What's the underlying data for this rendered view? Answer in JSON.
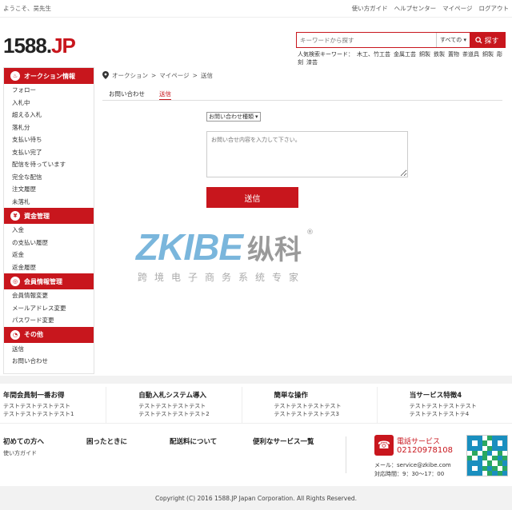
{
  "topbar": {
    "welcome": "ようこそ、吴先生",
    "links": [
      "使い方ガイド",
      "ヘルプセンター",
      "マイページ",
      "ログアウト"
    ]
  },
  "logo": {
    "main": "1588.",
    "accent": "JP"
  },
  "search": {
    "placeholder": "キーワードから探す",
    "category": "すべての",
    "button": "探す",
    "hot_label": "人気検索キーワード：",
    "hot_keywords": [
      "木工、竹工芸",
      "金属工芸",
      "銅製",
      "鉄製",
      "置物",
      "茶道具",
      "銅製",
      "彫刻",
      "漆芸"
    ]
  },
  "sidebar": {
    "sections": [
      {
        "title": "オークション情報",
        "icon": "auction-icon",
        "items": [
          "フォロー",
          "入札中",
          "超える入札",
          "落札分",
          "支払い待ち",
          "支払い完了",
          "配信を待っています",
          "完全な配信",
          "注文履歴",
          "未落札"
        ]
      },
      {
        "title": "資金管理",
        "icon": "yen-icon",
        "items": [
          "入金",
          "の支払い履歴",
          "返金",
          "返金履歴"
        ]
      },
      {
        "title": "会員情報管理",
        "icon": "member-icon",
        "items": [
          "会員情報変更",
          "メールアドレス変更",
          "パスワード変更"
        ]
      },
      {
        "title": "その他",
        "icon": "other-icon",
        "items": [
          "送信",
          "お問い合わせ"
        ]
      }
    ]
  },
  "breadcrumb": [
    "オークション",
    "マイページ",
    "送信"
  ],
  "tabs": [
    "お問い合わせ",
    "送信"
  ],
  "form": {
    "type_select": "お問い合わせ種類",
    "textarea_placeholder": "お問い合せ内容を入力して下さい。",
    "submit": "送信"
  },
  "watermark": {
    "latin": "ZKIBE",
    "cjk": "纵科",
    "tagline": "跨境电子商务系统专家",
    "reg": "®"
  },
  "features": [
    {
      "title": "年間会員制一番お得",
      "lines": [
        "テストテストテストテスト",
        "テストテストテストテスト1"
      ]
    },
    {
      "title": "自動入札システム導入",
      "lines": [
        "テストテストテストテスト",
        "テストテストテストテスト2"
      ]
    },
    {
      "title": "簡単な操作",
      "lines": [
        "テストテストテストテスト",
        "テストテストテストテス3"
      ]
    },
    {
      "title": "当サービス特徴4",
      "lines": [
        "テストテストテストテスト",
        "テストテストテストテ4"
      ]
    }
  ],
  "help": {
    "cols": [
      "初めての方へ",
      "困ったときに",
      "配送料について",
      "便利なサービス一覧"
    ],
    "guide_link": "使い方ガイド",
    "phone_label": "電話サービス",
    "phone_number": "02120978108",
    "mail": "メール：service@zkibe.com",
    "hours": "対応時間：9：30～17：00"
  },
  "footer": {
    "copyright": "Copyright (C) 2016 1588.JP Japan Corporation. All Rights Reserved."
  },
  "colors": {
    "accent": "#c8161d",
    "watermark_blue": "#7ab6dc"
  }
}
